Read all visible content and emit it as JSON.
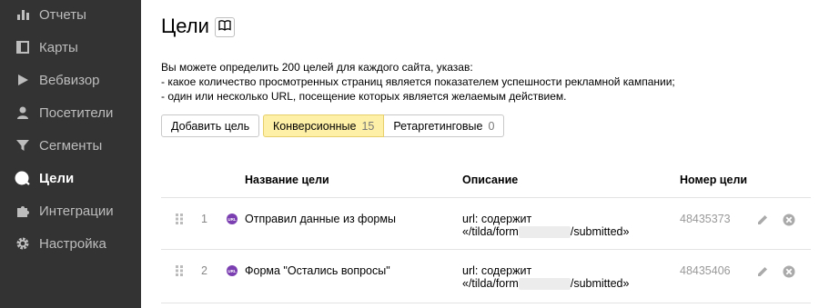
{
  "sidebar": {
    "items": [
      {
        "label": "Отчеты",
        "icon": "bar-chart-icon",
        "active": false
      },
      {
        "label": "Карты",
        "icon": "map-icon",
        "active": false
      },
      {
        "label": "Вебвизор",
        "icon": "play-icon",
        "active": false
      },
      {
        "label": "Посетители",
        "icon": "person-icon",
        "active": false
      },
      {
        "label": "Сегменты",
        "icon": "funnel-icon",
        "active": false
      },
      {
        "label": "Цели",
        "icon": "target-icon",
        "active": true
      },
      {
        "label": "Интеграции",
        "icon": "puzzle-icon",
        "active": false
      },
      {
        "label": "Настройка",
        "icon": "gear-icon",
        "active": false
      }
    ]
  },
  "header": {
    "title": "Цели",
    "help_icon": "book-icon"
  },
  "description": {
    "line1": "Вы можете определить 200 целей для каждого сайта, указав:",
    "line2": "-  какое количество просмотренных страниц является показателем успешности рекламной кампании;",
    "line3": "-  один или несколько URL, посещение которых является желаемым действием."
  },
  "toolbar": {
    "add_goal_label": "Добавить цель",
    "tabs": [
      {
        "label": "Конверсионные",
        "count": "15",
        "selected": true
      },
      {
        "label": "Ретаргетинговые",
        "count": "0",
        "selected": false
      }
    ]
  },
  "table": {
    "headers": {
      "name": "Название цели",
      "description": "Описание",
      "number": "Номер цели"
    },
    "rows": [
      {
        "index": "1",
        "type_badge": "URL",
        "name": "Отправил данные из формы",
        "desc_line1": "url: содержит",
        "desc_prefix": "«/tilda/form",
        "desc_suffix": "/submitted»",
        "number": "48435373"
      },
      {
        "index": "2",
        "type_badge": "URL",
        "name": "Форма \"Остались вопросы\"",
        "desc_line1": "url: содержит",
        "desc_prefix": "«/tilda/form",
        "desc_suffix": "/submitted»",
        "number": "48435406"
      }
    ]
  },
  "colors": {
    "sidebar_bg": "#333333",
    "selected_tab_bg": "#fff0a8",
    "url_badge": "#7b3fb1"
  }
}
